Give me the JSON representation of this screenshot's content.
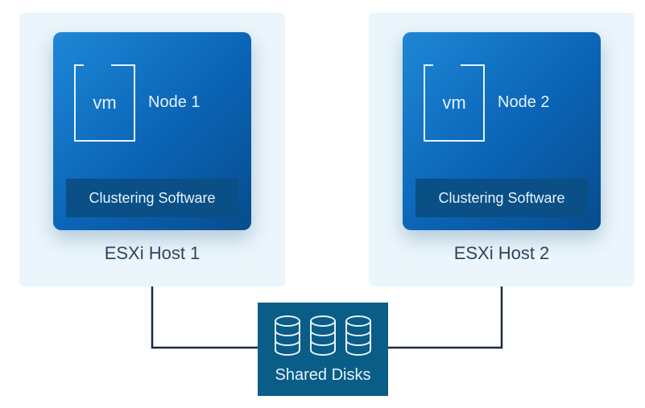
{
  "hosts": [
    {
      "host_label": "ESXi Host 1",
      "vm_text": "vm",
      "node_label": "Node 1",
      "cluster_label": "Clustering Software"
    },
    {
      "host_label": "ESXi Host 2",
      "vm_text": "vm",
      "node_label": "Node 2",
      "cluster_label": "Clustering Software"
    }
  ],
  "storage": {
    "label": "Shared Disks"
  }
}
